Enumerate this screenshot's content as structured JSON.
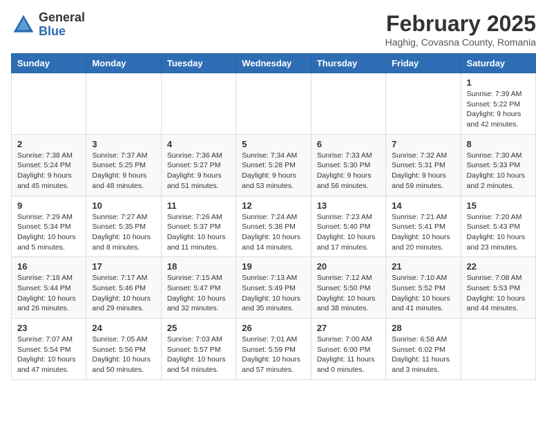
{
  "header": {
    "logo_general": "General",
    "logo_blue": "Blue",
    "month_year": "February 2025",
    "location": "Haghig, Covasna County, Romania"
  },
  "days_of_week": [
    "Sunday",
    "Monday",
    "Tuesday",
    "Wednesday",
    "Thursday",
    "Friday",
    "Saturday"
  ],
  "weeks": [
    [
      {
        "day": "",
        "info": ""
      },
      {
        "day": "",
        "info": ""
      },
      {
        "day": "",
        "info": ""
      },
      {
        "day": "",
        "info": ""
      },
      {
        "day": "",
        "info": ""
      },
      {
        "day": "",
        "info": ""
      },
      {
        "day": "1",
        "info": "Sunrise: 7:39 AM\nSunset: 5:22 PM\nDaylight: 9 hours and 42 minutes."
      }
    ],
    [
      {
        "day": "2",
        "info": "Sunrise: 7:38 AM\nSunset: 5:24 PM\nDaylight: 9 hours and 45 minutes."
      },
      {
        "day": "3",
        "info": "Sunrise: 7:37 AM\nSunset: 5:25 PM\nDaylight: 9 hours and 48 minutes."
      },
      {
        "day": "4",
        "info": "Sunrise: 7:36 AM\nSunset: 5:27 PM\nDaylight: 9 hours and 51 minutes."
      },
      {
        "day": "5",
        "info": "Sunrise: 7:34 AM\nSunset: 5:28 PM\nDaylight: 9 hours and 53 minutes."
      },
      {
        "day": "6",
        "info": "Sunrise: 7:33 AM\nSunset: 5:30 PM\nDaylight: 9 hours and 56 minutes."
      },
      {
        "day": "7",
        "info": "Sunrise: 7:32 AM\nSunset: 5:31 PM\nDaylight: 9 hours and 59 minutes."
      },
      {
        "day": "8",
        "info": "Sunrise: 7:30 AM\nSunset: 5:33 PM\nDaylight: 10 hours and 2 minutes."
      }
    ],
    [
      {
        "day": "9",
        "info": "Sunrise: 7:29 AM\nSunset: 5:34 PM\nDaylight: 10 hours and 5 minutes."
      },
      {
        "day": "10",
        "info": "Sunrise: 7:27 AM\nSunset: 5:35 PM\nDaylight: 10 hours and 8 minutes."
      },
      {
        "day": "11",
        "info": "Sunrise: 7:26 AM\nSunset: 5:37 PM\nDaylight: 10 hours and 11 minutes."
      },
      {
        "day": "12",
        "info": "Sunrise: 7:24 AM\nSunset: 5:38 PM\nDaylight: 10 hours and 14 minutes."
      },
      {
        "day": "13",
        "info": "Sunrise: 7:23 AM\nSunset: 5:40 PM\nDaylight: 10 hours and 17 minutes."
      },
      {
        "day": "14",
        "info": "Sunrise: 7:21 AM\nSunset: 5:41 PM\nDaylight: 10 hours and 20 minutes."
      },
      {
        "day": "15",
        "info": "Sunrise: 7:20 AM\nSunset: 5:43 PM\nDaylight: 10 hours and 23 minutes."
      }
    ],
    [
      {
        "day": "16",
        "info": "Sunrise: 7:18 AM\nSunset: 5:44 PM\nDaylight: 10 hours and 26 minutes."
      },
      {
        "day": "17",
        "info": "Sunrise: 7:17 AM\nSunset: 5:46 PM\nDaylight: 10 hours and 29 minutes."
      },
      {
        "day": "18",
        "info": "Sunrise: 7:15 AM\nSunset: 5:47 PM\nDaylight: 10 hours and 32 minutes."
      },
      {
        "day": "19",
        "info": "Sunrise: 7:13 AM\nSunset: 5:49 PM\nDaylight: 10 hours and 35 minutes."
      },
      {
        "day": "20",
        "info": "Sunrise: 7:12 AM\nSunset: 5:50 PM\nDaylight: 10 hours and 38 minutes."
      },
      {
        "day": "21",
        "info": "Sunrise: 7:10 AM\nSunset: 5:52 PM\nDaylight: 10 hours and 41 minutes."
      },
      {
        "day": "22",
        "info": "Sunrise: 7:08 AM\nSunset: 5:53 PM\nDaylight: 10 hours and 44 minutes."
      }
    ],
    [
      {
        "day": "23",
        "info": "Sunrise: 7:07 AM\nSunset: 5:54 PM\nDaylight: 10 hours and 47 minutes."
      },
      {
        "day": "24",
        "info": "Sunrise: 7:05 AM\nSunset: 5:56 PM\nDaylight: 10 hours and 50 minutes."
      },
      {
        "day": "25",
        "info": "Sunrise: 7:03 AM\nSunset: 5:57 PM\nDaylight: 10 hours and 54 minutes."
      },
      {
        "day": "26",
        "info": "Sunrise: 7:01 AM\nSunset: 5:59 PM\nDaylight: 10 hours and 57 minutes."
      },
      {
        "day": "27",
        "info": "Sunrise: 7:00 AM\nSunset: 6:00 PM\nDaylight: 11 hours and 0 minutes."
      },
      {
        "day": "28",
        "info": "Sunrise: 6:58 AM\nSunset: 6:02 PM\nDaylight: 11 hours and 3 minutes."
      },
      {
        "day": "",
        "info": ""
      }
    ]
  ]
}
